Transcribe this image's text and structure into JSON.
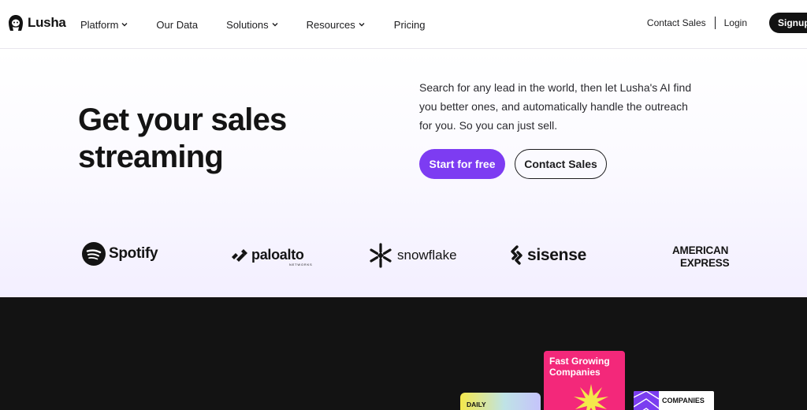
{
  "header": {
    "brand": "Lusha",
    "nav": [
      {
        "label": "Platform",
        "has_dropdown": true
      },
      {
        "label": "Our Data",
        "has_dropdown": false
      },
      {
        "label": "Solutions",
        "has_dropdown": true
      },
      {
        "label": "Resources",
        "has_dropdown": true
      },
      {
        "label": "Pricing",
        "has_dropdown": false
      }
    ],
    "contact_sales": "Contact Sales",
    "login": "Login",
    "signup": "Signup"
  },
  "hero": {
    "title_line1": "Get your sales",
    "title_line2": "streaming",
    "description": "Search for any lead in the world, then let Lusha's AI find you better ones, and automatically handle the outreach for you. So you can just sell.",
    "cta_primary": "Start for free",
    "cta_secondary": "Contact Sales"
  },
  "logos": {
    "spotify": "Spotify",
    "paloalto": "paloalto",
    "paloalto_sub": "NETWORKS",
    "snowflake": "snowflake",
    "sisense": "sisense",
    "amex_line1": "AMERICAN",
    "amex_line2": "EXPRESS"
  },
  "showcase": {
    "card_daily": "DAILY",
    "card_fast": "Fast Growing Companies",
    "card_companies": "COMPANIES"
  },
  "colors": {
    "accent": "#7d3cf2",
    "dark_bg": "#131313",
    "pink": "#f3287a",
    "yellow": "#f4e84b"
  },
  "icons": [
    "lusha-logo-icon",
    "chevron-down-icon",
    "spotify-icon",
    "paloalto-icon",
    "snowflake-icon",
    "sisense-icon",
    "starburst-icon"
  ]
}
